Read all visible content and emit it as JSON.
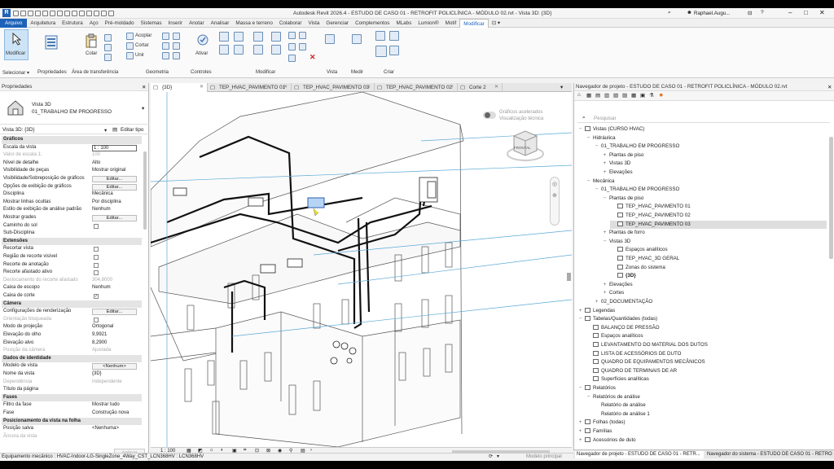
{
  "window": {
    "title": "Autodesk Revit 2026.4 - ESTUDO DE CASO 01 - RETROFIT POLICLÍNICA - MÓDULO 02.rvt - Vista 3D: {3D}",
    "user": "Raphael.Augu...",
    "app_logo": "R"
  },
  "ribbon_tabs": [
    "Arquivo",
    "Arquitetura",
    "Estrutura",
    "Aço",
    "Pré-moldado",
    "Sistemas",
    "Inserir",
    "Anotar",
    "Analisar",
    "Massa e terreno",
    "Colaborar",
    "Vista",
    "Gerenciar",
    "Complementos",
    "MLabs",
    "Lumion®",
    "Motif",
    "Modificar"
  ],
  "ribbon": {
    "modify_label": "Modificar",
    "paste_label": "Colar",
    "cope_label": "Acoplar",
    "cut_label": "Cortar",
    "join_label": "Unir",
    "activate_label": "Ativar",
    "panels": {
      "select": "Selecionar ▾",
      "properties": "Propriedades",
      "clipboard": "Área de transferência",
      "geometry": "Geometria",
      "controls": "Controles",
      "modify": "Modificar",
      "view": "Vista",
      "measure": "Medir",
      "create": "Criar"
    }
  },
  "properties": {
    "header": "Propriedades",
    "type_name": "Vista 3D",
    "type_sub": "01_TRABALHO EM PROGRESSO",
    "selector": "Vista 3D: {3D}",
    "edit_type": "Editar tipo",
    "apply": "Aplicar",
    "rows": [
      {
        "cat": "Gráficos"
      },
      {
        "k": "Escala da vista",
        "v": "1 : 100",
        "input": true
      },
      {
        "k": "Valor de escala    1:",
        "v": "100",
        "dis": true
      },
      {
        "k": "Nível de detalhe",
        "v": "Alto"
      },
      {
        "k": "Visibilidade de peças",
        "v": "Mostrar original"
      },
      {
        "k": "Visibilidade/Sobreposição de gráficos",
        "v": "Editar...",
        "btn": true
      },
      {
        "k": "Opções de exibição de gráficos",
        "v": "Editar...",
        "btn": true
      },
      {
        "k": "Disciplina",
        "v": "Mecânica"
      },
      {
        "k": "Mostrar linhas ocultas",
        "v": "Por disciplina"
      },
      {
        "k": "Estilo de exibição de análise padrão",
        "v": "Nenhum"
      },
      {
        "k": "Mostrar grades",
        "v": "Editar...",
        "btn": true
      },
      {
        "k": "Caminho do sol",
        "v": "",
        "chk": true
      },
      {
        "k": "Sub-Disciplina",
        "v": ""
      },
      {
        "cat": "Extensões"
      },
      {
        "k": "Recortar vista",
        "v": "",
        "chk": true
      },
      {
        "k": "Região de recorte visível",
        "v": "",
        "chk": true
      },
      {
        "k": "Recorte de anotação",
        "v": "",
        "chk": true
      },
      {
        "k": "Recorte afastado ativo",
        "v": "",
        "chk": true
      },
      {
        "k": "Deslocamento do recorte afastado",
        "v": "304,8000",
        "dis": true
      },
      {
        "k": "Caixa de escopo",
        "v": "Nenhum"
      },
      {
        "k": "Caixa de corte",
        "v": "",
        "chk": true,
        "checked": true
      },
      {
        "cat": "Câmera"
      },
      {
        "k": "Configurações de renderização",
        "v": "Editar...",
        "btn": true
      },
      {
        "k": "Orientação bloqueada",
        "v": "",
        "chk": true,
        "dis": true
      },
      {
        "k": "Modo de projeção",
        "v": "Ortogonal"
      },
      {
        "k": "Elevação do olho",
        "v": "9,9921"
      },
      {
        "k": "Elevação alvo",
        "v": "8,2900"
      },
      {
        "k": "Posição da câmera",
        "v": "Ajustada",
        "dis": true
      },
      {
        "cat": "Dados de identidade"
      },
      {
        "k": "Modelo de vista",
        "v": "<Nenhum>",
        "btn": true
      },
      {
        "k": "Nome da vista",
        "v": "{3D}"
      },
      {
        "k": "Dependência",
        "v": "Independente",
        "dis": true
      },
      {
        "k": "Título da página",
        "v": ""
      },
      {
        "cat": "Fases"
      },
      {
        "k": "Filtro da fase",
        "v": "Mostrar tudo"
      },
      {
        "k": "Fase",
        "v": "Construção nova"
      },
      {
        "cat": "Posicionamento da vista na folha"
      },
      {
        "k": "Posição salva",
        "v": "<Nenhuma>"
      },
      {
        "k": "Âncora da vista",
        "v": "",
        "dis": true
      }
    ]
  },
  "view_tabs": [
    "{3D}",
    "TEP_HVAC_PAVIMENTO 01",
    "TEP_HVAC_PAVIMENTO 03",
    "TEP_HVAC_PAVIMENTO 02",
    "Corte 2"
  ],
  "canvas": {
    "overlay_line1": "Gráficos acelerados",
    "overlay_line2": "Visualização técnica",
    "viewcube_face": "FRONTAL",
    "scale": "1 : 100"
  },
  "browser": {
    "header": "Navegador de projeto - ESTUDO DE CASO 01 - RETROFIT POLICLÍNICA - MÓDULO 02.rvt",
    "search_placeholder": "Pesquisar",
    "items": [
      {
        "l": 0,
        "g": "−",
        "i": true,
        "t": "Vistas (CURSO HVAC)"
      },
      {
        "l": 1,
        "g": "−",
        "t": "Hidráulica"
      },
      {
        "l": 2,
        "g": "−",
        "t": "01_TRABALHO EM PROGRESSO"
      },
      {
        "l": 3,
        "g": "+",
        "t": "Plantas de piso"
      },
      {
        "l": 3,
        "g": "+",
        "t": "Vistas 3D"
      },
      {
        "l": 3,
        "g": "+",
        "t": "Elevações"
      },
      {
        "l": 1,
        "g": "−",
        "t": "Mecânica"
      },
      {
        "l": 2,
        "g": "−",
        "t": "01_TRABALHO EM PROGRESSO"
      },
      {
        "l": 3,
        "g": "−",
        "t": "Plantas de piso"
      },
      {
        "l": 4,
        "g": "",
        "i": true,
        "t": "TEP_HVAC_PAVIMENTO 01"
      },
      {
        "l": 4,
        "g": "",
        "i": true,
        "t": "TEP_HVAC_PAVIMENTO 02"
      },
      {
        "l": 4,
        "g": "",
        "i": true,
        "t": "TEP_HVAC_PAVIMENTO 03",
        "sel": true
      },
      {
        "l": 3,
        "g": "+",
        "t": "Plantas de forro"
      },
      {
        "l": 3,
        "g": "−",
        "t": "Vistas 3D"
      },
      {
        "l": 4,
        "g": "",
        "i": true,
        "t": "Espaços analíticos"
      },
      {
        "l": 4,
        "g": "",
        "i": true,
        "t": "TEP_HVAC_3D GERAL"
      },
      {
        "l": 4,
        "g": "",
        "i": true,
        "t": "Zonas do sistema"
      },
      {
        "l": 4,
        "g": "",
        "i": true,
        "t": "{3D}",
        "b": true
      },
      {
        "l": 3,
        "g": "+",
        "t": "Elevações"
      },
      {
        "l": 3,
        "g": "+",
        "t": "Cortes"
      },
      {
        "l": 2,
        "g": "+",
        "t": "02_DOCUMENTAÇÃO"
      },
      {
        "l": 0,
        "g": "+",
        "i": true,
        "t": "Legendas"
      },
      {
        "l": 0,
        "g": "−",
        "i": true,
        "t": "Tabelas/Quantidades (todas)"
      },
      {
        "l": 1,
        "g": "",
        "i": true,
        "t": "BALANÇO DE PRESSÃO"
      },
      {
        "l": 1,
        "g": "",
        "i": true,
        "t": "Espaços analíticos"
      },
      {
        "l": 1,
        "g": "",
        "i": true,
        "t": "LEVANTAMENTO DO MATERIAL DOS DUTOS"
      },
      {
        "l": 1,
        "g": "",
        "i": true,
        "t": "LISTA DE ACESSÓRIOS DE DUTO"
      },
      {
        "l": 1,
        "g": "",
        "i": true,
        "t": "QUADRO DE EQUIPAMENTOS MECÂNICOS"
      },
      {
        "l": 1,
        "g": "",
        "i": true,
        "t": "QUADRO DE TERMINAIS DE AR"
      },
      {
        "l": 1,
        "g": "",
        "i": true,
        "t": "Superfícies analíticas"
      },
      {
        "l": 0,
        "g": "−",
        "i": true,
        "t": "Relatórios"
      },
      {
        "l": 1,
        "g": "−",
        "t": "Relatórios de análise"
      },
      {
        "l": 2,
        "g": "",
        "t": "Relatório de análise"
      },
      {
        "l": 2,
        "g": "",
        "t": "Relatório de análise 1"
      },
      {
        "l": 0,
        "g": "+",
        "i": true,
        "t": "Folhas (todas)"
      },
      {
        "l": 0,
        "g": "+",
        "i": true,
        "t": "Famílias"
      },
      {
        "l": 0,
        "g": "+",
        "i": true,
        "t": "Acessórios de duto"
      }
    ]
  },
  "bottom_tabs": [
    "Navegador de projeto - ESTUDO DE CASO 01 - RETR...",
    "Navegador do sistema - ESTUDO DE CASO 01 - RETRO..."
  ],
  "status": {
    "text": "Equipamento mecânico : HVAC-Indoor-LG-SingleZone_4Way_CST_LCN368HV : LCN368HV",
    "model": "Modelo principal"
  }
}
